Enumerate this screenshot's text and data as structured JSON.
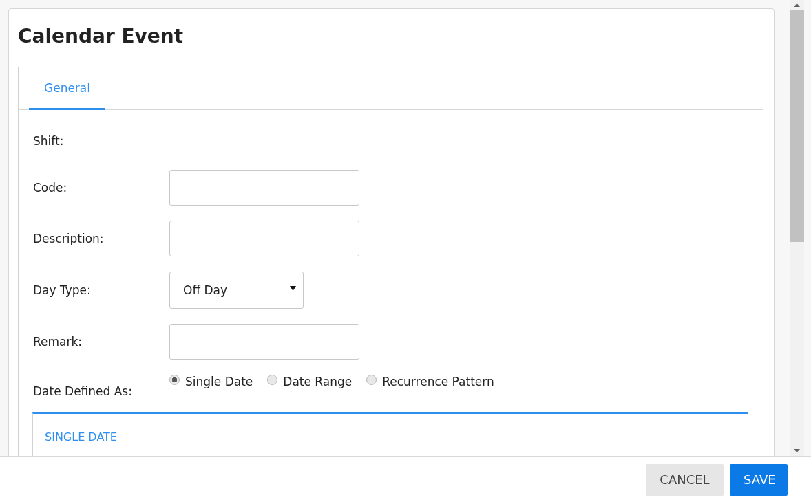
{
  "dialog": {
    "title": "Calendar Event"
  },
  "tabs": [
    {
      "label": "General",
      "selected": true
    }
  ],
  "fields": [
    {
      "kind": "label",
      "label": "Shift:"
    },
    {
      "kind": "text",
      "label": "Code:"
    },
    {
      "kind": "text",
      "label": "Description:"
    },
    {
      "kind": "select",
      "label": "Day Type:",
      "value": "Off Day"
    },
    {
      "kind": "text",
      "label": "Remark:"
    }
  ],
  "date_defined_as": {
    "label": "Date Defined As:",
    "options": [
      {
        "label": "Single Date",
        "selected": true
      },
      {
        "label": "Date Range",
        "selected": false
      },
      {
        "label": "Recurrence Pattern",
        "selected": false
      }
    ]
  },
  "section": {
    "title": "SINGLE DATE"
  },
  "buttons": [
    {
      "kind": "secondary",
      "label": "CANCEL"
    },
    {
      "kind": "primary",
      "label": "SAVE"
    }
  ]
}
